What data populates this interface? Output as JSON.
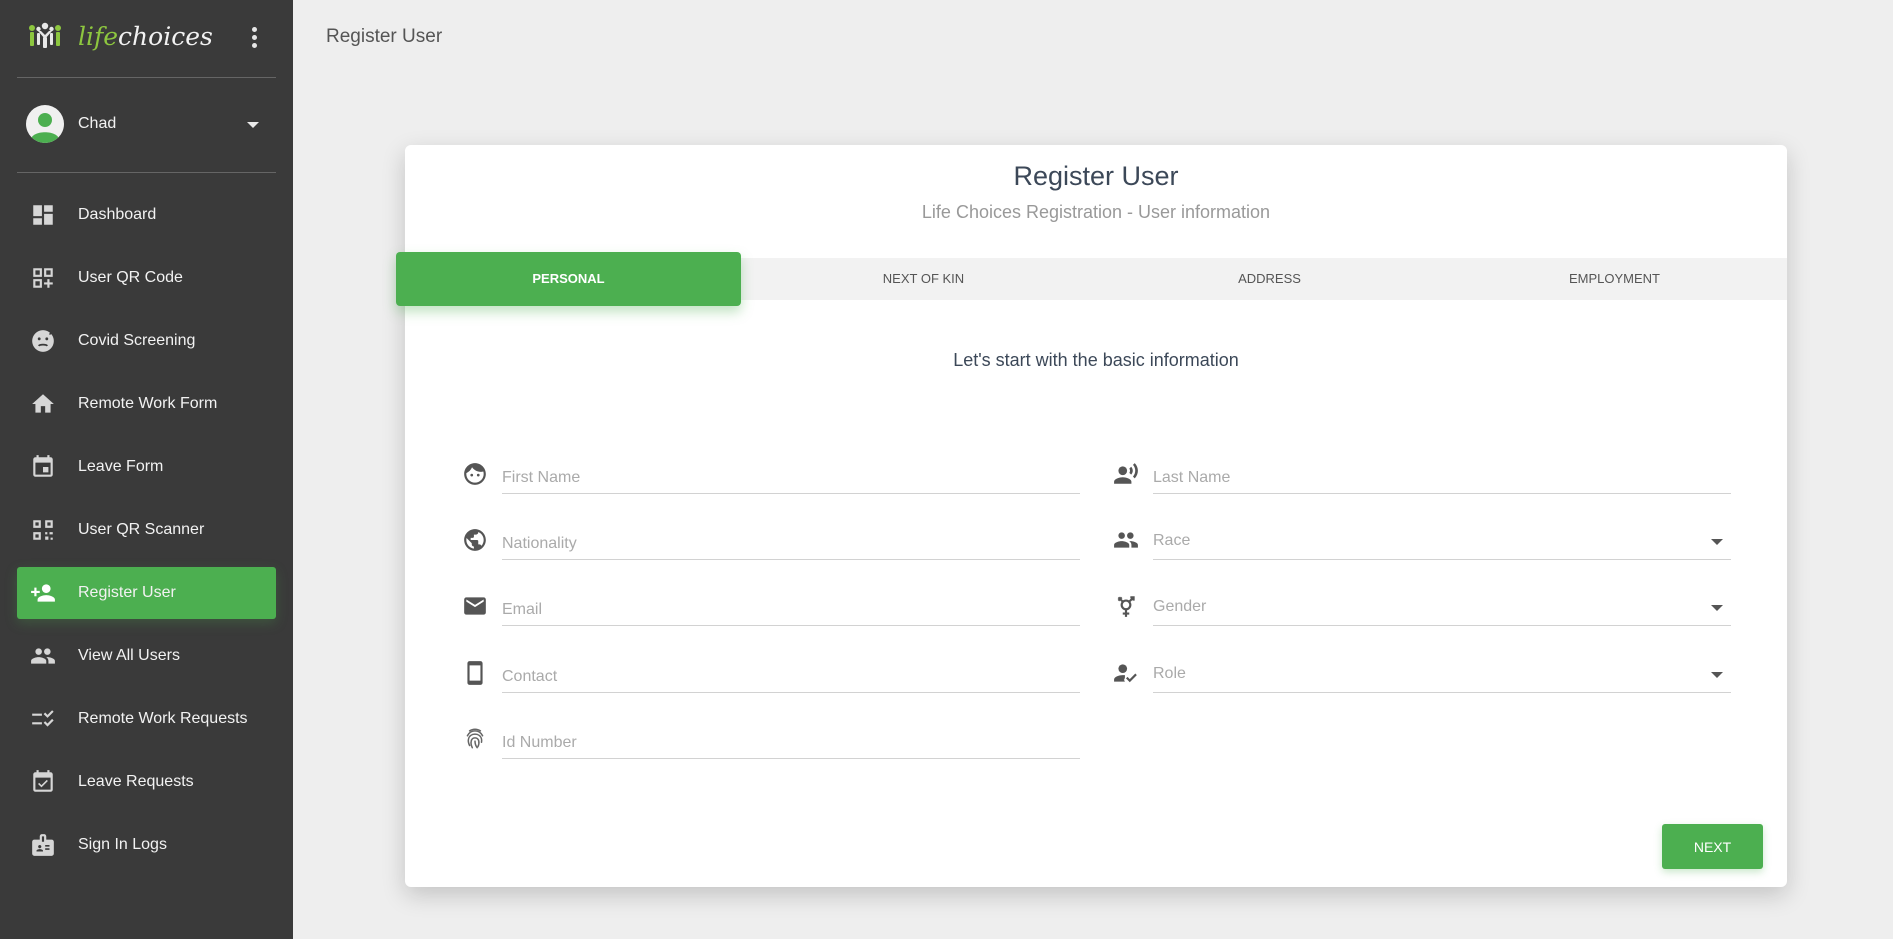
{
  "app": {
    "logo_text_life": "life",
    "logo_text_choices": "choices",
    "brand_color": "#4caf50",
    "sidebar_color": "#3a3a3a"
  },
  "user": {
    "name": "Chad"
  },
  "sidebar": {
    "items": [
      {
        "label": "Dashboard",
        "icon": "dashboard-icon",
        "active": false
      },
      {
        "label": "User QR Code",
        "icon": "qr-code-icon",
        "active": false
      },
      {
        "label": "Covid Screening",
        "icon": "sick-face-icon",
        "active": false
      },
      {
        "label": "Remote Work Form",
        "icon": "home-icon",
        "active": false
      },
      {
        "label": "Leave Form",
        "icon": "calendar-icon",
        "active": false
      },
      {
        "label": "User QR Scanner",
        "icon": "qr-scanner-icon",
        "active": false
      },
      {
        "label": "Register User",
        "icon": "person-add-icon",
        "active": true
      },
      {
        "label": "View All Users",
        "icon": "people-icon",
        "active": false
      },
      {
        "label": "Remote Work Requests",
        "icon": "checklist-icon",
        "active": false
      },
      {
        "label": "Leave Requests",
        "icon": "event-check-icon",
        "active": false
      },
      {
        "label": "Sign In Logs",
        "icon": "badge-icon",
        "active": false
      }
    ]
  },
  "header": {
    "title": "Register User"
  },
  "card": {
    "title": "Register User",
    "subtitle": "Life Choices Registration - User information",
    "tabs": [
      {
        "label": "PERSONAL",
        "active": true
      },
      {
        "label": "NEXT OF KIN",
        "active": false
      },
      {
        "label": "ADDRESS",
        "active": false
      },
      {
        "label": "EMPLOYMENT",
        "active": false
      }
    ],
    "section_heading": "Let's start with the basic information",
    "fields": {
      "first_name": {
        "placeholder": "First Name",
        "value": "",
        "icon": "face-icon"
      },
      "last_name": {
        "placeholder": "Last Name",
        "value": "",
        "icon": "record-voice-icon"
      },
      "nationality": {
        "placeholder": "Nationality",
        "value": "",
        "icon": "globe-icon"
      },
      "race": {
        "placeholder": "Race",
        "value": "",
        "icon": "group-icon"
      },
      "email": {
        "placeholder": "Email",
        "value": "",
        "icon": "mail-icon"
      },
      "gender": {
        "placeholder": "Gender",
        "value": "",
        "icon": "transgender-icon"
      },
      "contact": {
        "placeholder": "Contact",
        "value": "",
        "icon": "phone-icon"
      },
      "role": {
        "placeholder": "Role",
        "value": "",
        "icon": "person-check-icon"
      },
      "id_number": {
        "placeholder": "Id Number",
        "value": "",
        "icon": "fingerprint-icon"
      }
    },
    "next_label": "NEXT"
  }
}
